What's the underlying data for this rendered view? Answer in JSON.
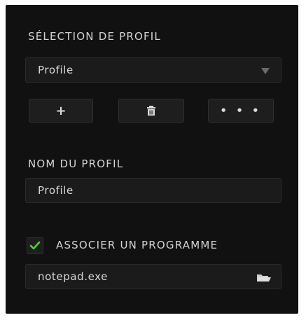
{
  "profile_selection": {
    "title": "SÉLECTION DE PROFIL",
    "selected_value": "Profile",
    "add_label": "+",
    "delete_icon": "trash-icon",
    "more_label": "• • •"
  },
  "profile_name": {
    "title": "NOM DU PROFIL",
    "value": "Profile"
  },
  "link_program": {
    "checked": true,
    "label": "ASSOCIER UN PROGRAMME",
    "program_value": "notepad.exe",
    "browse_icon": "folder-icon"
  },
  "colors": {
    "accent_green": "#44d62c",
    "panel_bg": "#111111"
  }
}
